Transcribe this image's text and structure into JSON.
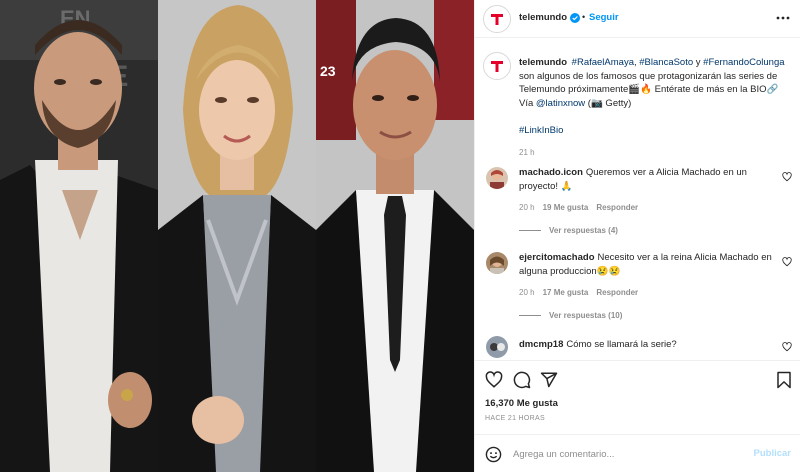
{
  "post": {
    "author": "telemundo",
    "follow_label": "Seguir",
    "caption": {
      "username": "telemundo",
      "tags_line": [
        "#RafaelAmaya",
        "#BlancaSoto",
        "#FernandoColunga"
      ],
      "sep1": ", ",
      "sep2": " y ",
      "text1": " son algunos de los famosos que protagonizarán las series de Telemundo próximamente🎬🔥 Entérate de más en la BIO🔗 Vía ",
      "mention": "@latinxnow",
      "text2": " (📷 Getty)",
      "link_tag": "#LinkInBio",
      "time": "21 h"
    },
    "comments": [
      {
        "username": "machado.icon",
        "text": "Queremos ver a Alicia Machado en un proyecto! 🙏",
        "time": "20 h",
        "likes": "19 Me gusta",
        "reply": "Responder",
        "view_replies": "Ver respuestas (4)"
      },
      {
        "username": "ejercitomachado",
        "text": "Necesito ver a la reina Alicia Machado en alguna produccion😢😢",
        "time": "20 h",
        "likes": "17 Me gusta",
        "reply": "Responder",
        "view_replies": "Ver respuestas (10)"
      },
      {
        "username": "dmcmp18",
        "text": "Cómo se llamará la serie?"
      }
    ],
    "likes_total": "16,370 Me gusta",
    "time_total": "HACE 21 HORAS",
    "comment_placeholder": "Agrega un comentario...",
    "publish_label": "Publicar"
  },
  "colors": {
    "accent_blue": "#0095f6",
    "brand_red": "#e4002b",
    "publish_disabled": "#b2dffc"
  },
  "icons": [
    "telemundo-logo",
    "verified-badge-icon",
    "more-options-icon",
    "heart-icon",
    "comment-icon",
    "share-icon",
    "save-icon",
    "emoji-icon"
  ]
}
